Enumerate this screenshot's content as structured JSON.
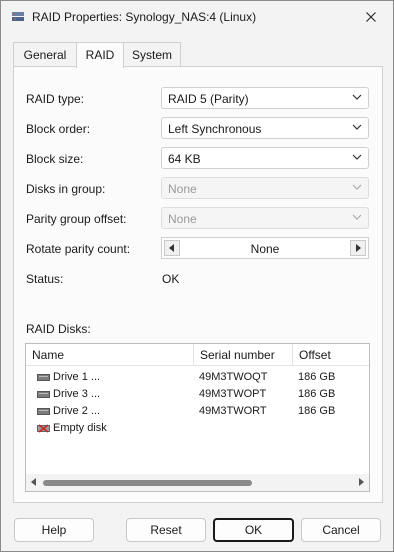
{
  "window": {
    "title": "RAID Properties: Synology_NAS:4 (Linux)"
  },
  "tabs": [
    {
      "label": "General"
    },
    {
      "label": "RAID"
    },
    {
      "label": "System"
    }
  ],
  "form": {
    "raid_type": {
      "label": "RAID type:",
      "value": "RAID 5 (Parity)"
    },
    "block_order": {
      "label": "Block order:",
      "value": "Left Synchronous"
    },
    "block_size": {
      "label": "Block size:",
      "value": "64 KB"
    },
    "disks_in_group": {
      "label": "Disks in group:",
      "value": "None"
    },
    "parity_group_offset": {
      "label": "Parity group offset:",
      "value": "None"
    },
    "rotate_parity_count": {
      "label": "Rotate parity count:",
      "value": "None"
    },
    "status": {
      "label": "Status:",
      "value": "OK"
    }
  },
  "raid_disks": {
    "label": "RAID Disks:",
    "columns": [
      "Name",
      "Serial number",
      "Offset"
    ],
    "rows": [
      {
        "name": "Drive 1 ...",
        "serial": "49M3TWOQT",
        "offset": "186 GB",
        "icon": "drive-icon"
      },
      {
        "name": "Drive 3 ...",
        "serial": "49M3TWOPT",
        "offset": "186 GB",
        "icon": "drive-icon"
      },
      {
        "name": "Drive 2 ...",
        "serial": "49M3TWORT",
        "offset": "186 GB",
        "icon": "drive-icon"
      },
      {
        "name": "Empty disk",
        "serial": "",
        "offset": "",
        "icon": "empty-disk-icon"
      }
    ]
  },
  "buttons": {
    "help": "Help",
    "reset": "Reset",
    "ok": "OK",
    "cancel": "Cancel"
  },
  "colors": {
    "window_bg": "#f3f3f3",
    "panel_bg": "#fbfbfb",
    "disabled_text": "#9a9a9a",
    "empty_disk_red": "#c62828"
  }
}
